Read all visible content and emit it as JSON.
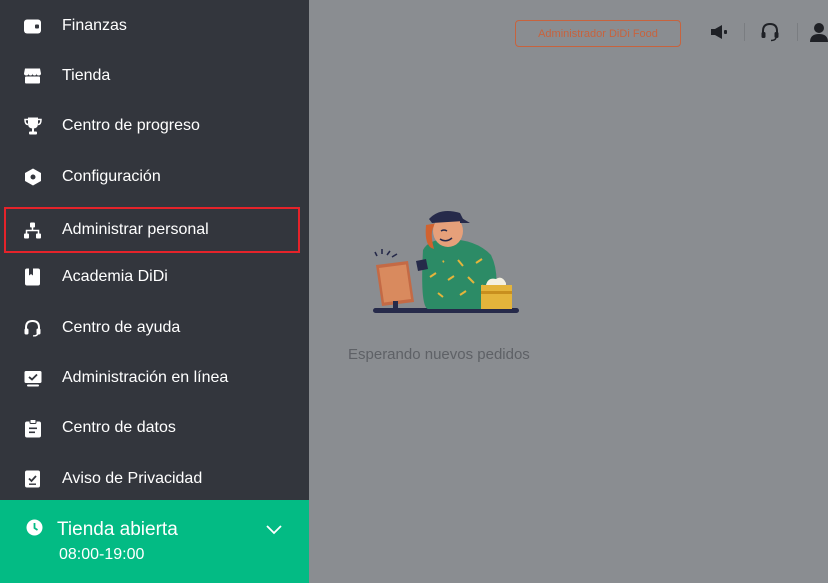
{
  "sidebar": {
    "items": [
      {
        "label": "Finanzas",
        "icon": "wallet-icon"
      },
      {
        "label": "Tienda",
        "icon": "store-icon"
      },
      {
        "label": "Centro de progreso",
        "icon": "trophy-icon"
      },
      {
        "label": "Configuración",
        "icon": "settings-icon"
      },
      {
        "label": "Administrar personal",
        "icon": "org-chart-icon"
      },
      {
        "label": "Academia DiDi",
        "icon": "book-icon"
      },
      {
        "label": "Centro de ayuda",
        "icon": "headset-icon"
      },
      {
        "label": "Administración en línea",
        "icon": "monitor-check-icon"
      },
      {
        "label": "Centro de datos",
        "icon": "clipboard-icon"
      },
      {
        "label": "Aviso de Privacidad",
        "icon": "document-check-icon"
      }
    ]
  },
  "store_status": {
    "label": "Tienda abierta",
    "hours": "08:00-19:00"
  },
  "header": {
    "admin_button": "Administrador DiDi Food"
  },
  "main": {
    "empty_message": "Esperando nuevos pedidos"
  },
  "colors": {
    "sidebar_bg": "#33363d",
    "status_green": "#03bb84",
    "accent_orange": "#c7633e",
    "highlight_red": "#e5232a",
    "overlay_gray": "#8a8d91"
  }
}
